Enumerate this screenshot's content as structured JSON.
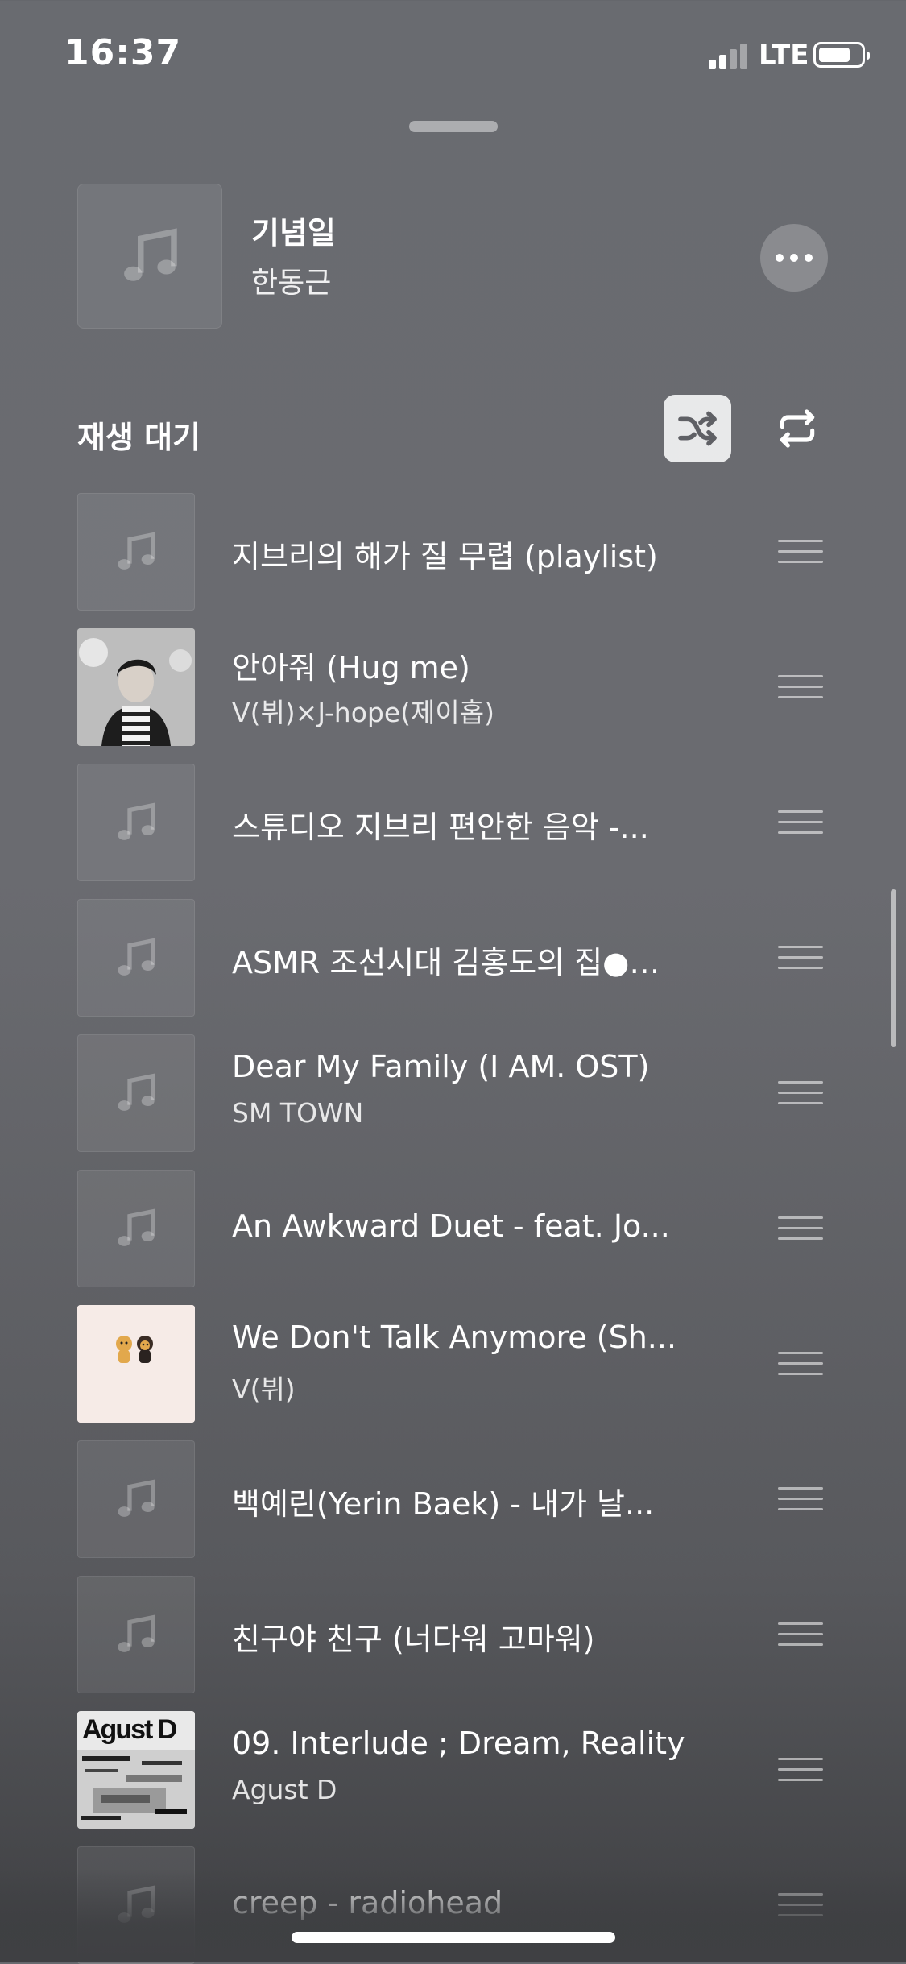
{
  "status_bar": {
    "time": "16:37",
    "network": "LTE",
    "signal_bars_active": 2,
    "signal_bars_total": 4,
    "battery_level": 0.75
  },
  "now_playing": {
    "title": "기념일",
    "artist": "한동근",
    "more_icon": "ellipsis-icon"
  },
  "queue": {
    "label": "재생 대기",
    "shuffle_icon": "shuffle-icon",
    "repeat_icon": "repeat-icon",
    "shuffle_active": true,
    "items": [
      {
        "title": "지브리의 해가 질 무렵 (playlist)",
        "artist": "",
        "art": "placeholder"
      },
      {
        "title": "안아줘 (Hug me)",
        "artist": "V(뷔)×J-hope(제이홉)",
        "art": "photo"
      },
      {
        "title": "스튜디오 지브리 편안한 음악 -...",
        "artist": "",
        "art": "placeholder"
      },
      {
        "title": "ASMR 조선시대 김홍도의 집●…",
        "artist": "",
        "art": "placeholder"
      },
      {
        "title": "Dear My Family (I AM. OST)",
        "artist": "SM TOWN",
        "art": "placeholder"
      },
      {
        "title": "An Awkward Duet - feat. Jo...",
        "artist": "",
        "art": "placeholder"
      },
      {
        "title": "We Don't Talk Anymore (Sh...",
        "artist": "V(뷔)",
        "art": "illustration"
      },
      {
        "title": "백예린(Yerin Baek) - 내가 날...",
        "artist": "",
        "art": "placeholder"
      },
      {
        "title": "친구야 친구 (너다워 고마워)",
        "artist": "",
        "art": "placeholder"
      },
      {
        "title": "09. Interlude ; Dream, Reality",
        "artist": "Agust D",
        "art": "album",
        "art_text": "Agust D"
      },
      {
        "title": "creep - radiohead",
        "artist": "",
        "art": "placeholder"
      }
    ]
  },
  "colors": {
    "background": "#6a6b70",
    "shuffle_bg": "#d9d9db",
    "shuffle_icon": "#5f6065"
  }
}
